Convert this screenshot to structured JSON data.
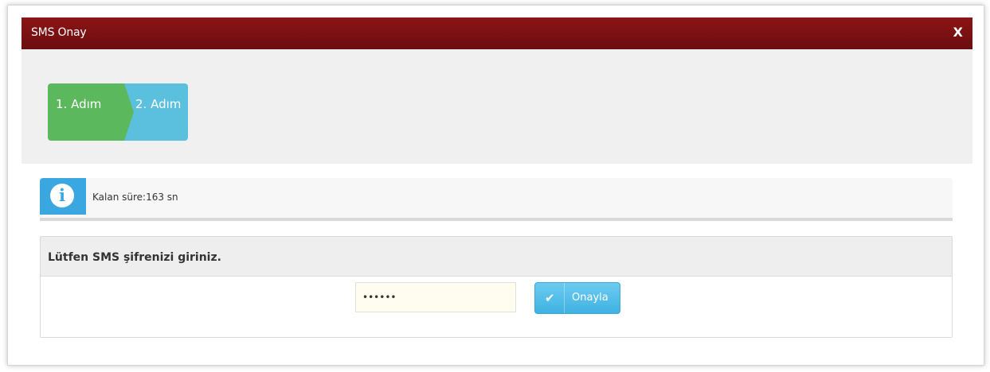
{
  "dialog": {
    "title": "SMS Onay",
    "close_label": "X"
  },
  "steps": [
    {
      "label": "1. Adım",
      "color": "#5cb85c",
      "state": "completed"
    },
    {
      "label": "2. Adım",
      "color": "#5bc0de",
      "state": "active"
    }
  ],
  "alert": {
    "icon": "info-icon",
    "label": "Kalan süre:",
    "value": "163 sn"
  },
  "form": {
    "heading": "Lütfen SMS şifrenizi giriniz.",
    "sms_value": "••••••",
    "confirm_label": "Onayla",
    "confirm_icon": "check-icon"
  },
  "colors": {
    "titlebar": "#7a1012",
    "step_done": "#5cb85c",
    "step_active": "#5bc0de",
    "info": "#3aa7e0",
    "button": "#3fb2e2"
  }
}
